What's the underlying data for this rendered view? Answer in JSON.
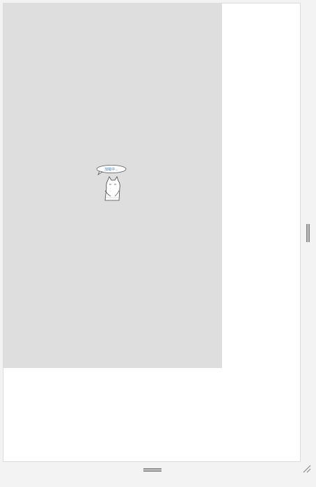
{
  "canvas": {
    "background": "#dedede"
  },
  "mascot": {
    "icon": "cat-with-speech-bubble-icon",
    "bubble_text": "加载中..."
  },
  "handles": {
    "vertical": "vertical-resize-handle-icon",
    "horizontal": "horizontal-resize-handle-icon",
    "corner": "corner-resize-grip-icon"
  },
  "colors": {
    "page_bg": "#f3f3f3",
    "panel_bg": "#ffffff",
    "bubble_text": "#3a7fc4"
  }
}
